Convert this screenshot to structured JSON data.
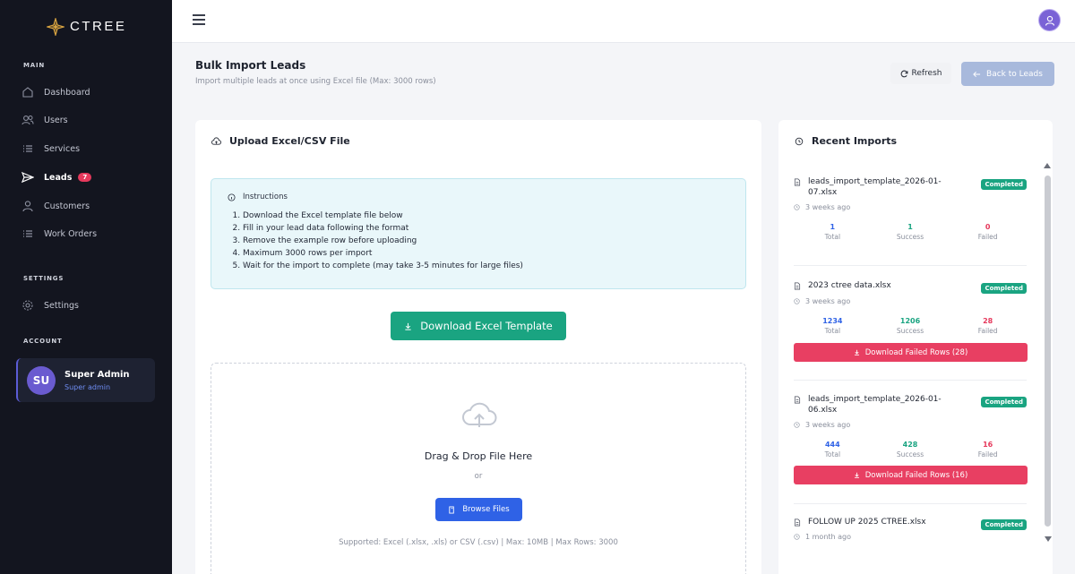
{
  "app": {
    "brand": "CTREE"
  },
  "sidebar": {
    "sections": {
      "main": "MAIN",
      "settings": "SETTINGS",
      "account": "ACCOUNT"
    },
    "items": [
      {
        "label": "Dashboard",
        "icon": "home-icon"
      },
      {
        "label": "Users",
        "icon": "users-icon"
      },
      {
        "label": "Services",
        "icon": "list-icon"
      },
      {
        "label": "Leads",
        "icon": "send-icon",
        "badge": "7",
        "active": true
      },
      {
        "label": "Customers",
        "icon": "user-icon"
      },
      {
        "label": "Work Orders",
        "icon": "list-icon"
      }
    ],
    "settings_item": {
      "label": "Settings",
      "icon": "gear-icon"
    },
    "account": {
      "initials": "SU",
      "name": "Super Admin",
      "role": "Super admin"
    }
  },
  "header": {
    "title": "Bulk Import Leads",
    "subtitle": "Import multiple leads at once using Excel file (Max: 3000 rows)",
    "refresh_label": "Refresh",
    "back_label": "Back to Leads"
  },
  "upload": {
    "title": "Upload Excel/CSV File",
    "instructions_title": "Instructions",
    "instructions": [
      "Download the Excel template file below",
      "Fill in your lead data following the format",
      "Remove the example row before uploading",
      "Maximum 3000 rows per import",
      "Wait for the import to complete (may take 3-5 minutes for large files)"
    ],
    "download_template_label": "Download Excel Template",
    "drop_title": "Drag & Drop File Here",
    "drop_or": "or",
    "browse_label": "Browse Files",
    "supported_text": "Supported: Excel (.xlsx, .xls) or CSV (.csv) | Max: 10MB | Max Rows: 3000"
  },
  "recent": {
    "title": "Recent Imports",
    "labels": {
      "total": "Total",
      "success": "Success",
      "failed": "Failed"
    },
    "imports": [
      {
        "file": "leads_import_template_2026-01-07.xlsx",
        "status": "Completed",
        "time": "3 weeks ago",
        "total": "1",
        "success": "1",
        "failed": "0"
      },
      {
        "file": "2023 ctree data.xlsx",
        "status": "Completed",
        "time": "3 weeks ago",
        "total": "1234",
        "success": "1206",
        "failed": "28",
        "failed_button": "Download Failed Rows (28)"
      },
      {
        "file": "leads_import_template_2026-01-06.xlsx",
        "status": "Completed",
        "time": "3 weeks ago",
        "total": "444",
        "success": "428",
        "failed": "16",
        "failed_button": "Download Failed Rows (16)"
      },
      {
        "file": "FOLLOW UP 2025 CTREE.xlsx",
        "status": "Completed",
        "time": "1 month ago"
      }
    ]
  },
  "colors": {
    "sidebar_bg": "#13151f",
    "accent_green": "#1aa481",
    "accent_blue": "#2f62e6",
    "danger": "#e83f62",
    "back_button": "#a8b9dc"
  }
}
